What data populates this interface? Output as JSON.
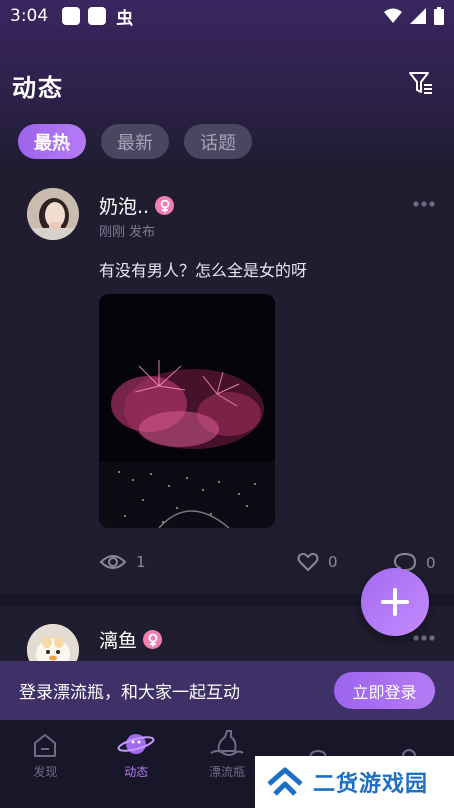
{
  "status_bar": {
    "time": "3:04",
    "bug_glyph": "虫"
  },
  "header": {
    "title": "动态"
  },
  "tabs": [
    {
      "label": "最热",
      "active": true
    },
    {
      "label": "最新",
      "active": false
    },
    {
      "label": "话题",
      "active": false
    }
  ],
  "posts": [
    {
      "username": "奶泡..",
      "gender": "female",
      "time": "刚刚 发布",
      "text": "有没有男人？怎么全是女的呀",
      "image": "fireworks-night-city",
      "views": "1",
      "likes": "0",
      "comments": "0"
    },
    {
      "username": "漓鱼",
      "gender": "female"
    }
  ],
  "login_banner": {
    "text": "登录漂流瓶，和大家一起互动",
    "button": "立即登录"
  },
  "bottom_nav": [
    {
      "label": "发现",
      "icon": "home-icon",
      "active": false
    },
    {
      "label": "动态",
      "icon": "planet-icon",
      "active": true
    },
    {
      "label": "漂流瓶",
      "icon": "bottle-icon",
      "active": false
    },
    {
      "label": "",
      "icon": "bell-icon",
      "active": false
    },
    {
      "label": "",
      "icon": "profile-icon",
      "active": false
    }
  ],
  "watermark": {
    "text": "二货游戏园"
  },
  "colors": {
    "accent": "#b57bf4",
    "background": "#1c1a2c",
    "female_badge": "#f27fb3"
  }
}
